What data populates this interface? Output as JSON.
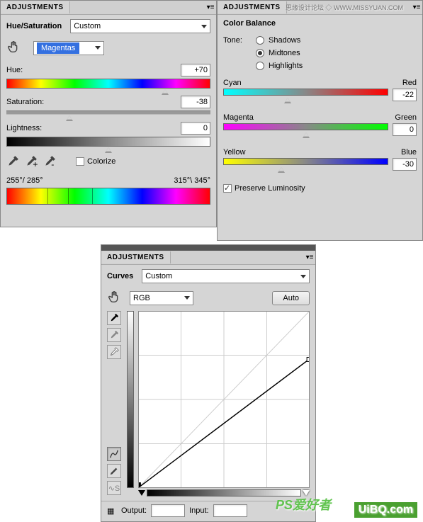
{
  "hue_sat": {
    "panel_title": "ADJUSTMENTS",
    "title": "Hue/Saturation",
    "preset": "Custom",
    "edit": "Magentas",
    "hue_label": "Hue:",
    "hue_value": "+70",
    "sat_label": "Saturation:",
    "sat_value": "-38",
    "light_label": "Lightness:",
    "light_value": "0",
    "colorize_label": "Colorize",
    "range_left": "255°/ 285°",
    "range_right": "315°\\ 345°"
  },
  "color_balance": {
    "panel_title": "ADJUSTMENTS",
    "title": "Color Balance",
    "tone_label": "Tone:",
    "shadows": "Shadows",
    "midtones": "Midtones",
    "highlights": "Highlights",
    "cyan": "Cyan",
    "red": "Red",
    "cr_value": "-22",
    "magenta": "Magenta",
    "green": "Green",
    "mg_value": "0",
    "yellow": "Yellow",
    "blue": "Blue",
    "yb_value": "-30",
    "preserve": "Preserve Luminosity"
  },
  "curves": {
    "panel_title": "ADJUSTMENTS",
    "title": "Curves",
    "preset": "Custom",
    "channel": "RGB",
    "auto": "Auto",
    "output_label": "Output:",
    "output_value": "",
    "input_label": "Input:",
    "input_value": ""
  },
  "watermarks": {
    "top": "思缘设计论坛 ◇ WWW.MISSYUAN.COM",
    "bottom_left": "PS爱好者",
    "bottom_right": "UiBQ.com"
  }
}
